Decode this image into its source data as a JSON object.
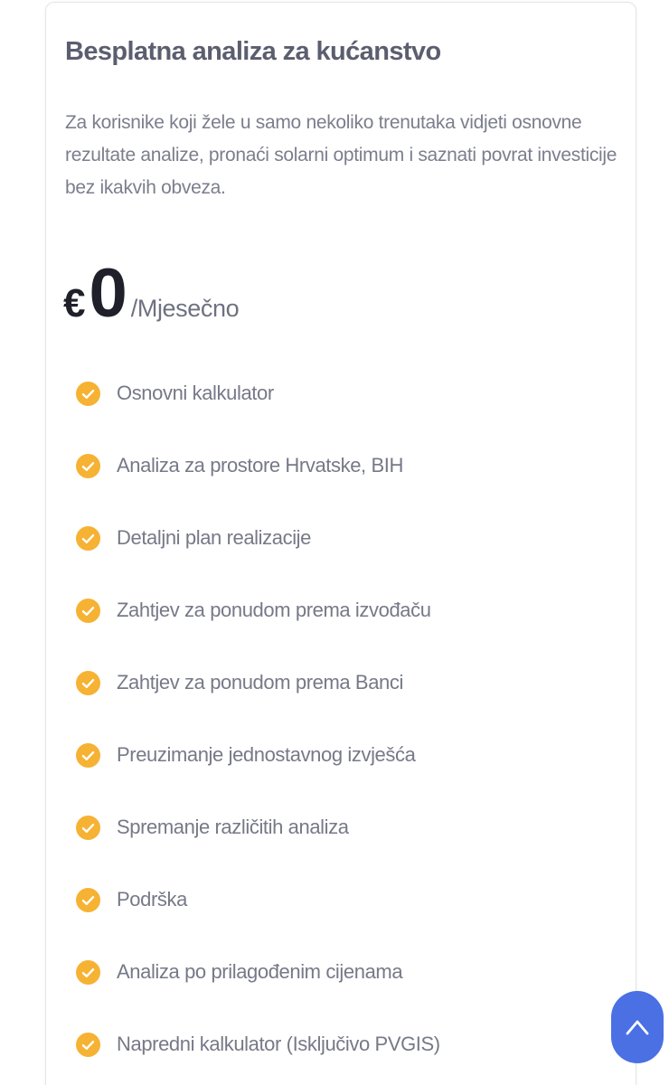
{
  "plan": {
    "title": "Besplatna analiza za kućanstvo",
    "description": "Za korisnike koji žele u samo nekoliko trenutaka vidjeti osnovne rezultate analize, pronaći solarni optimum i saznati povrat investicije bez ikakvih obveza.",
    "price": {
      "currency": "€",
      "amount": "0",
      "period": "/Mjesečno"
    },
    "features": [
      {
        "label": "Osnovni kalkulator",
        "icon": "check-circle-icon"
      },
      {
        "label": "Analiza za prostore Hrvatske, BIH",
        "icon": "check-circle-icon"
      },
      {
        "label": "Detaljni plan realizacije",
        "icon": "check-circle-icon"
      },
      {
        "label": "Zahtjev za ponudom prema izvođaču",
        "icon": "check-circle-icon"
      },
      {
        "label": "Zahtjev za ponudom prema Banci",
        "icon": "check-circle-icon"
      },
      {
        "label": "Preuzimanje jednostavnog izvješća",
        "icon": "check-circle-icon"
      },
      {
        "label": "Spremanje različitih analiza",
        "icon": "check-circle-icon"
      },
      {
        "label": "Podrška",
        "icon": "check-circle-icon"
      },
      {
        "label": "Analiza po prilagođenim cijenama",
        "icon": "check-circle-icon"
      },
      {
        "label": "Napredni kalkulator (Isključivo PVGIS)",
        "icon": "check-circle-icon"
      }
    ]
  },
  "scroll_top_button": {
    "icon": "chevron-up-icon"
  },
  "colors": {
    "check_accent": "#f6b233",
    "scroll_button": "#4a70e4",
    "title_text": "#5b5e6e",
    "body_text": "#7b7e8c",
    "price_text": "#1f2029"
  }
}
